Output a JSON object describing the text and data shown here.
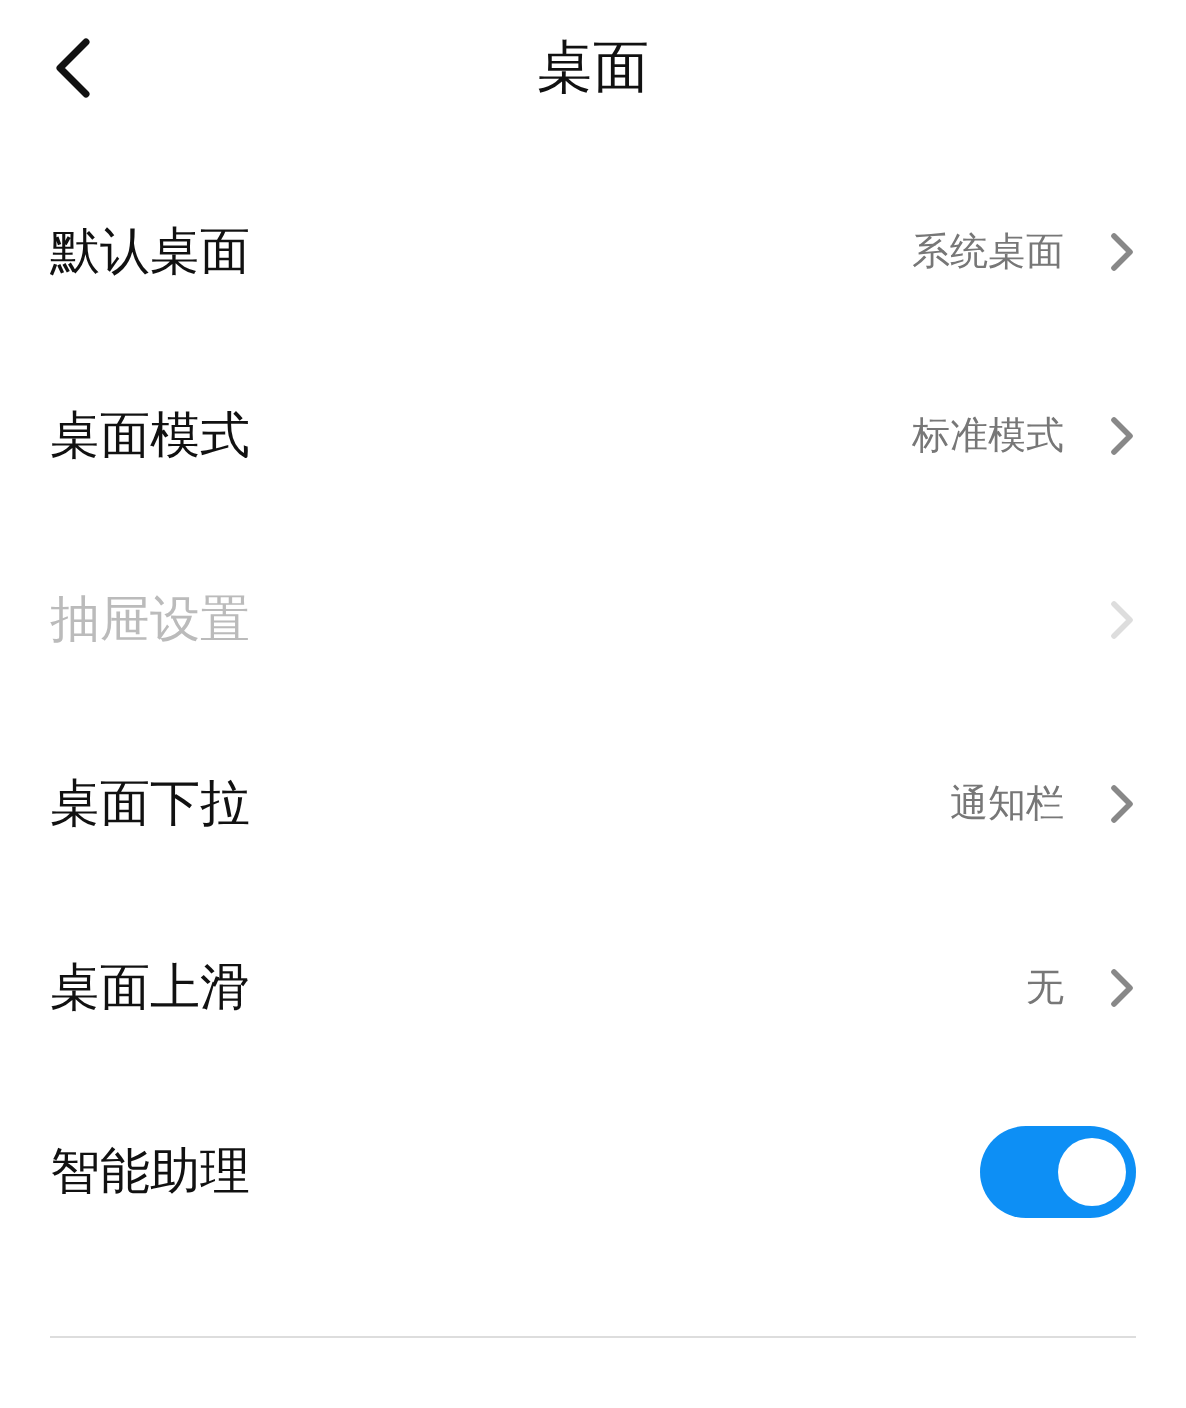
{
  "header": {
    "title": "桌面"
  },
  "items": [
    {
      "kind": "link",
      "label": "默认桌面",
      "value": "系统桌面",
      "disabled": false
    },
    {
      "kind": "link",
      "label": "桌面模式",
      "value": "标准模式",
      "disabled": false
    },
    {
      "kind": "link",
      "label": "抽屉设置",
      "disabled": true
    },
    {
      "kind": "link",
      "label": "桌面下拉",
      "value": "通知栏",
      "disabled": false
    },
    {
      "kind": "link",
      "label": "桌面上滑",
      "value": "无",
      "disabled": false
    },
    {
      "kind": "switch",
      "label": "智能助理",
      "on": true
    }
  ]
}
